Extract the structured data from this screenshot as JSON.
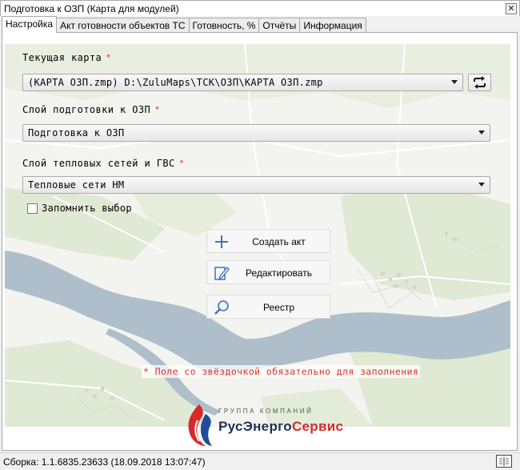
{
  "window": {
    "title": "Подготовка к ОЗП (Карта для модулей)",
    "close_glyph": "✕"
  },
  "tabs": [
    {
      "label": "Настройка",
      "active": true
    },
    {
      "label": "Акт готовности объектов ТС",
      "active": false
    },
    {
      "label": "Готовность, %",
      "active": false
    },
    {
      "label": "Отчёты",
      "active": false
    },
    {
      "label": "Информация",
      "active": false
    }
  ],
  "form": {
    "current_map": {
      "label": "Текущая карта",
      "required_mark": "*",
      "value": "(КАРТА ОЗП.zmp) D:\\ZuluMaps\\ТСК\\ОЗП\\КАРТА ОЗП.zmp",
      "refresh_icon": "refresh-icon"
    },
    "prep_layer": {
      "label": "Слой подготовки к ОЗП",
      "required_mark": "*",
      "value": "Подготовка к ОЗП"
    },
    "heat_layer": {
      "label": "Слой тепловых сетей и ГВС",
      "required_mark": "*",
      "value": "Тепловые сети НМ"
    },
    "remember": {
      "label": "Запомнить выбор",
      "checked": false
    }
  },
  "actions": {
    "create": {
      "label": "Создать акт",
      "icon": "plus-icon"
    },
    "edit": {
      "label": "Редактировать",
      "icon": "edit-icon"
    },
    "registry": {
      "label": "Реестр",
      "icon": "magnifier-icon"
    }
  },
  "note": "* Поле со звёздочкой обязательно для заполнения",
  "logo": {
    "group_text": "ГРУППА КОМПАНИЙ",
    "brand_part1": "РусЭнерго",
    "brand_part2": "Сервис"
  },
  "status": {
    "build": "Сборка: 1.1.6835.23633 (18.09.2018 13:07:47)",
    "book_icon": "book-icon"
  },
  "colors": {
    "required": "#e4302b",
    "brand_blue": "#1f2e5c",
    "brand_red": "#d62a2a",
    "river": "#aebfcb"
  }
}
